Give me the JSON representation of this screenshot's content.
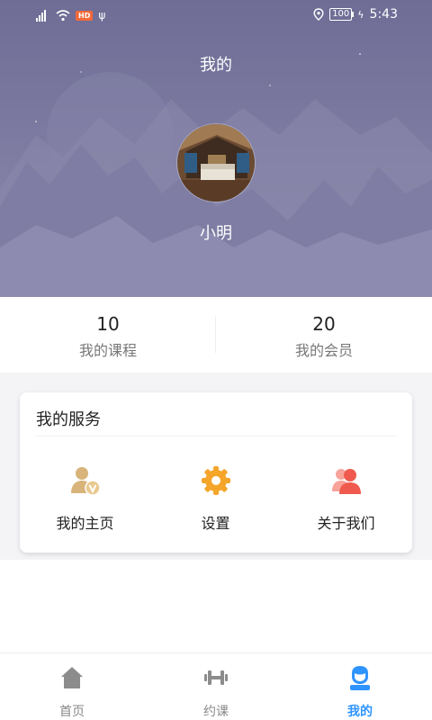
{
  "status_bar": {
    "hd_label": "HD",
    "battery": "100",
    "time": "5:43"
  },
  "header": {
    "title": "我的",
    "username": "小明"
  },
  "stats": [
    {
      "value": "10",
      "label": "我的课程"
    },
    {
      "value": "20",
      "label": "我的会员"
    }
  ],
  "services": {
    "title": "我的服务",
    "items": [
      {
        "label": "我的主页",
        "icon": "user-v-icon"
      },
      {
        "label": "设置",
        "icon": "gear-icon"
      },
      {
        "label": "关于我们",
        "icon": "users-icon"
      }
    ]
  },
  "nav": {
    "items": [
      {
        "label": "首页",
        "icon": "home-icon",
        "active": false
      },
      {
        "label": "约课",
        "icon": "dumbbell-icon",
        "active": false
      },
      {
        "label": "我的",
        "icon": "profile-icon",
        "active": true
      }
    ]
  },
  "colors": {
    "header_bg": "#74729a",
    "accent": "#2f94ff",
    "gear": "#f5a52a",
    "user_v": "#d8b47a",
    "users": "#f05a4e"
  }
}
